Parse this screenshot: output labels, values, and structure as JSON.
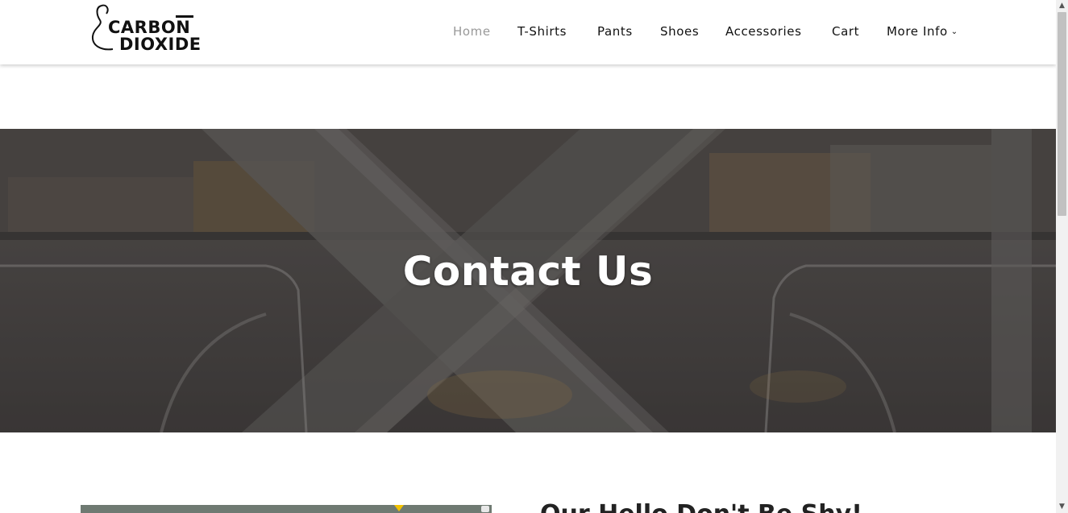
{
  "logo": {
    "line1": "CARBON",
    "line2": "DIOXIDE"
  },
  "nav": [
    {
      "label": "Home",
      "active": true
    },
    {
      "label": "T-Shirts",
      "active": false
    },
    {
      "label": "Pants",
      "active": false
    },
    {
      "label": "Shoes",
      "active": false
    },
    {
      "label": "Accessories",
      "active": false
    },
    {
      "label": "Cart",
      "active": false
    },
    {
      "label": "More Info",
      "active": false,
      "dropdown": true
    }
  ],
  "hero": {
    "title": "Contact Us"
  },
  "contact": {
    "heading": "Our Hello Don't Be Shy!"
  },
  "colors": {
    "nav_active": "#999999",
    "text": "#111111",
    "hero_overlay": "#4a4747"
  }
}
